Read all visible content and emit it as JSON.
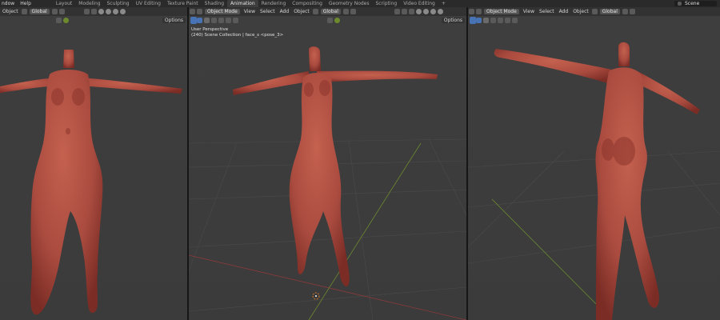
{
  "topbar": {
    "menus": [
      "ndow",
      "Help"
    ],
    "workspace_tabs": [
      "Layout",
      "Modeling",
      "Sculpting",
      "UV Editing",
      "Texture Paint",
      "Shading",
      "Animation",
      "Rendering",
      "Compositing",
      "Geometry Nodes",
      "Scripting",
      "Video Editing"
    ],
    "active_tab": "Animation",
    "add_tab": "+",
    "scene_label": "Scene"
  },
  "viewports": [
    {
      "mode": "Object",
      "transform": "Global",
      "options_label": "Options"
    },
    {
      "mode": "Object Mode",
      "menus": [
        "View",
        "Select",
        "Add",
        "Object"
      ],
      "transform": "Global",
      "options_label": "Options",
      "overlay_line1": "User Perspective",
      "overlay_line2": "(240) Scene Collection | face_s <pose_3>"
    },
    {
      "mode": "Object Mode",
      "menus": [
        "View",
        "Select",
        "Add",
        "Object"
      ],
      "transform": "Global"
    }
  ],
  "colors": {
    "body": "#b65246",
    "body_dark": "#7e2e26",
    "grid": "#4a4a4a",
    "x_axis": "#8a3a3a",
    "y_axis": "#6d8a2e",
    "accent": "#4772b3"
  }
}
